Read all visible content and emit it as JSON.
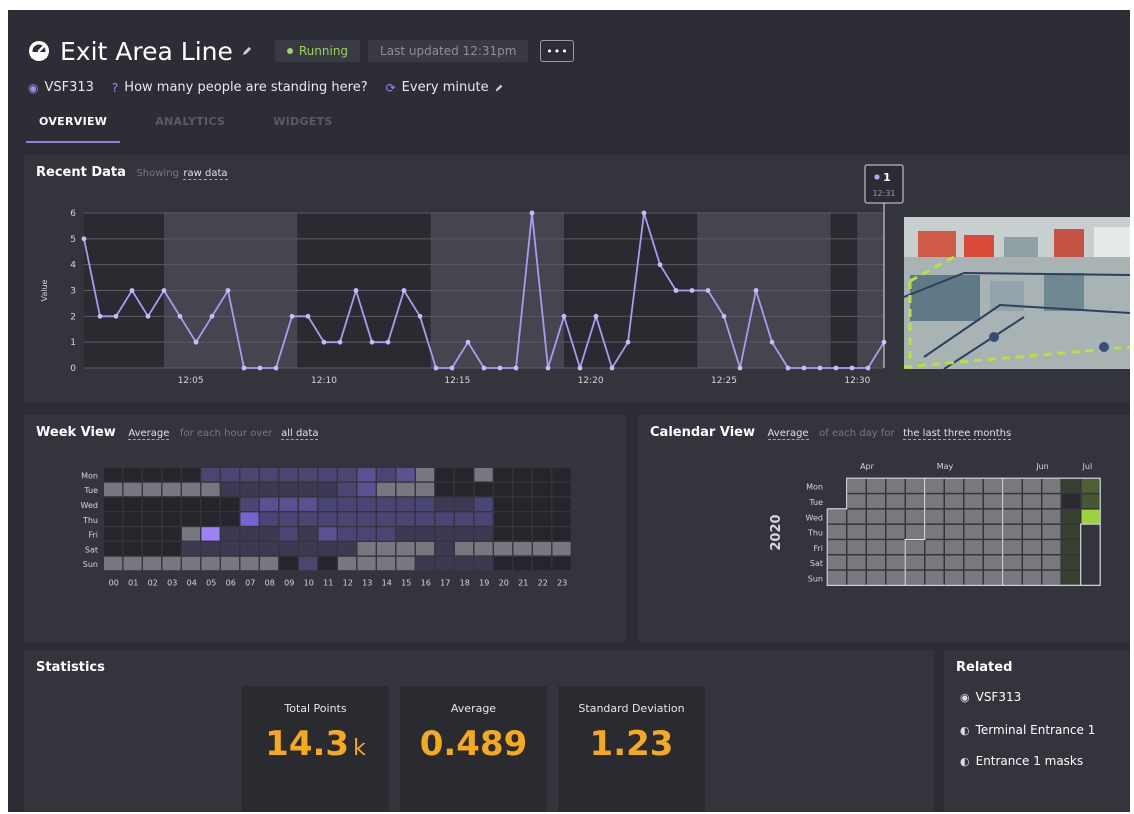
{
  "header": {
    "title": "Exit Area Line",
    "status": "Running",
    "last_updated": "Last updated 12:31pm",
    "more_label": "•••",
    "sensor": "VSF313",
    "question": "How many people are standing here?",
    "frequency": "Every minute",
    "colors": {
      "accent": "#8e7fe0",
      "running": "#9ad35e",
      "highlight": "#f5a91c"
    },
    "icons": [
      "gauge-icon",
      "pencil-icon",
      "sensor-icon",
      "question-icon",
      "refresh-icon"
    ]
  },
  "tabs": [
    {
      "label": "OVERVIEW",
      "active": true
    },
    {
      "label": "ANALYTICS",
      "active": false
    },
    {
      "label": "WIDGETS",
      "active": false
    }
  ],
  "recent": {
    "title": "Recent Data",
    "showing": "Showing",
    "mode": "raw data",
    "tooltip_value": "1",
    "tooltip_time": "12:31"
  },
  "week": {
    "title": "Week View",
    "agg": "Average",
    "middle": "for each hour over",
    "range": "all data"
  },
  "calendar": {
    "title": "Calendar View",
    "agg": "Average",
    "middle": "of each day for",
    "range": "the last three months"
  },
  "stats": {
    "title": "Statistics",
    "cards": [
      {
        "label": "Total Points",
        "value": "14.3",
        "unit": "k"
      },
      {
        "label": "Average",
        "value": "0.489",
        "unit": ""
      },
      {
        "label": "Standard Deviation",
        "value": "1.23",
        "unit": ""
      }
    ]
  },
  "related": {
    "title": "Related",
    "items": [
      {
        "label": "VSF313",
        "icon": "sensor-icon"
      },
      {
        "label": "Terminal Entrance 1",
        "icon": "gauge-icon"
      },
      {
        "label": "Entrance 1 masks",
        "icon": "gauge-icon"
      }
    ]
  },
  "chart_data": [
    {
      "type": "line",
      "ylabel": "Value",
      "ylim": [
        0,
        6
      ],
      "yticks": [
        0,
        1,
        2,
        3,
        4,
        5,
        6
      ],
      "xticks": [
        "12:05",
        "12:10",
        "12:15",
        "12:20",
        "12:25",
        "12:30"
      ],
      "x_start": "12:01",
      "x_end": "12:31",
      "color": "#a99bf0",
      "grid": true,
      "values": [
        5,
        2,
        2,
        3,
        2,
        3,
        2,
        1,
        2,
        3,
        0,
        0,
        0,
        2,
        2,
        1,
        1,
        3,
        1,
        1,
        3,
        2,
        0,
        0,
        1,
        0,
        0,
        0,
        6,
        0,
        2,
        0,
        2,
        0,
        1,
        6,
        4,
        3,
        3,
        3,
        2,
        0,
        3,
        1,
        0,
        0,
        0,
        0,
        0,
        0,
        1
      ]
    },
    {
      "type": "heatmap",
      "rows": [
        "Mon",
        "Tue",
        "Wed",
        "Thu",
        "Fri",
        "Sat",
        "Sun"
      ],
      "columns": [
        "00",
        "01",
        "02",
        "03",
        "04",
        "05",
        "06",
        "07",
        "08",
        "09",
        "10",
        "11",
        "12",
        "13",
        "14",
        "15",
        "16",
        "17",
        "18",
        "19",
        "20",
        "21",
        "22",
        "23"
      ],
      "values": [
        [
          0,
          0,
          0,
          0,
          0,
          2,
          2,
          2,
          2,
          2,
          2,
          2,
          2,
          3,
          2,
          3,
          6,
          0,
          0,
          6,
          0,
          0,
          0,
          0
        ],
        [
          6,
          6,
          6,
          6,
          6,
          6,
          1,
          1,
          1,
          1,
          1,
          1,
          2,
          3,
          6,
          6,
          6,
          0,
          0,
          0,
          0,
          0,
          0,
          0
        ],
        [
          0,
          0,
          0,
          0,
          0,
          0,
          0,
          2,
          3,
          3,
          3,
          2,
          2,
          2,
          2,
          2,
          2,
          1,
          1,
          2,
          0,
          0,
          0,
          0
        ],
        [
          0,
          0,
          0,
          0,
          0,
          0,
          0,
          4,
          2,
          2,
          2,
          2,
          2,
          2,
          2,
          2,
          2,
          2,
          2,
          2,
          0,
          0,
          0,
          0
        ],
        [
          0,
          0,
          0,
          0,
          6,
          5,
          1,
          1,
          1,
          2,
          1,
          3,
          2,
          2,
          2,
          1,
          1,
          1,
          1,
          1,
          0,
          0,
          0,
          0
        ],
        [
          0,
          0,
          0,
          0,
          1,
          1,
          1,
          1,
          1,
          1,
          1,
          1,
          1,
          6,
          6,
          6,
          6,
          1,
          6,
          6,
          6,
          6,
          6,
          6
        ],
        [
          6,
          6,
          6,
          6,
          6,
          6,
          6,
          6,
          6,
          0,
          2,
          0,
          6,
          6,
          6,
          6,
          1,
          1,
          1,
          1,
          0,
          0,
          0,
          0
        ]
      ]
    },
    {
      "type": "heatmap",
      "title": "2020",
      "rows": [
        "Mon",
        "Tue",
        "Wed",
        "Thu",
        "Fri",
        "Sat",
        "Sun"
      ],
      "months": [
        "Apr",
        "May",
        "Jun",
        "Jul"
      ]
    }
  ]
}
